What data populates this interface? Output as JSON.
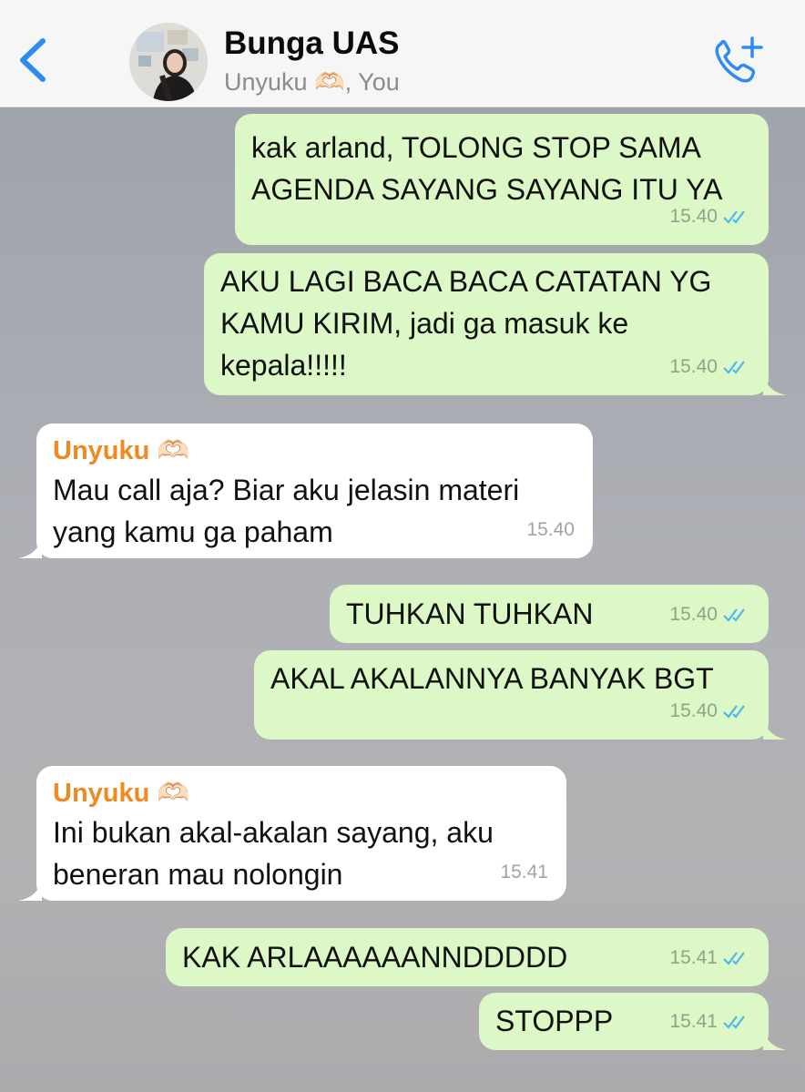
{
  "header": {
    "title": "Bunga UAS",
    "subtitle": "Unyuku 🫶🏻, You"
  },
  "colors": {
    "accent": "#2e8bf0",
    "outgoing_bubble": "#dcf8c6",
    "incoming_bubble": "#ffffff",
    "sender_name": "#ef8a21",
    "read_ticks": "#4fb6ec"
  },
  "icons": {
    "back": "chevron-left-icon",
    "call": "phone-plus-icon",
    "read": "double-check-icon"
  },
  "messages": [
    {
      "direction": "out",
      "text": "kak arland, TOLONG STOP SAMA\nAGENDA SAYANG SAYANG ITU YA",
      "time": "15.40"
    },
    {
      "direction": "out",
      "text": "AKU LAGI BACA BACA CATATAN YG\nKAMU KIRIM, jadi ga masuk ke\nkepala!!!!!",
      "time": "15.40"
    },
    {
      "direction": "in",
      "sender": "Unyuku 🫶🏻",
      "text": "Mau call aja? Biar aku jelasin materi\nyang kamu ga paham",
      "time": "15.40"
    },
    {
      "direction": "out",
      "text": "TUHKAN TUHKAN",
      "time": "15.40"
    },
    {
      "direction": "out",
      "text": "AKAL AKALANNYA BANYAK BGT",
      "time": "15.40"
    },
    {
      "direction": "in",
      "sender": "Unyuku 🫶🏻",
      "text": "Ini bukan akal-akalan sayang, aku\nbeneran mau nolongin",
      "time": "15.41"
    },
    {
      "direction": "out",
      "text": "KAK ARLAAAAAANNDDDDD",
      "time": "15.41"
    },
    {
      "direction": "out",
      "text": "STOPPP",
      "time": "15.41"
    }
  ]
}
